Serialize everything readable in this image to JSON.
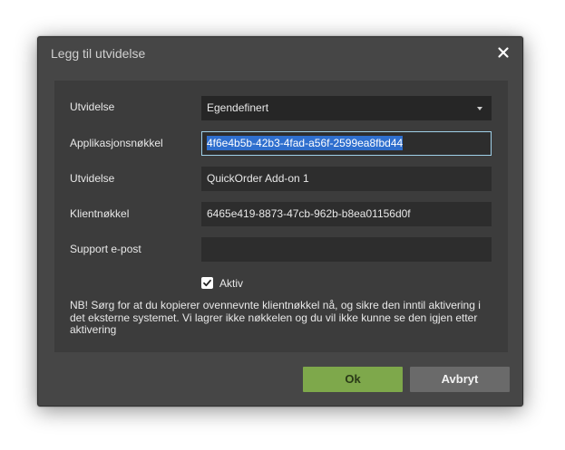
{
  "dialog": {
    "title": "Legg til utvidelse",
    "close_icon": "close-icon"
  },
  "form": {
    "extension_label": "Utvidelse",
    "extension_value": "Egendefinert",
    "app_key_label": "Applikasjonsnøkkel",
    "app_key_value": "4f6e4b5b-42b3-4fad-a56f-2599ea8fbd44",
    "extension_name_label": "Utvidelse",
    "extension_name_value": "QuickOrder Add-on 1",
    "client_key_label": "Klientnøkkel",
    "client_key_value": "6465e419-8873-47cb-962b-b8ea01156d0f",
    "support_email_label": "Support e-post",
    "support_email_value": "",
    "active_label": "Aktiv",
    "active_checked": true,
    "note": "NB! Sørg for at du kopierer ovennevnte klientnøkkel nå, og sikre den inntil aktivering i det eksterne systemet. Vi lagrer ikke nøkkelen og du vil ikke kunne se den igjen etter aktivering"
  },
  "buttons": {
    "ok_label": "Ok",
    "cancel_label": "Avbryt"
  },
  "colors": {
    "dialog_bg": "#464646",
    "panel_bg": "#3c3c3c",
    "field_bg": "#2d2d2d",
    "ok_button": "#7ea84b",
    "cancel_button": "#6a6a6a",
    "focus_border": "#9fd0e8",
    "selection": "#2f6fce"
  }
}
